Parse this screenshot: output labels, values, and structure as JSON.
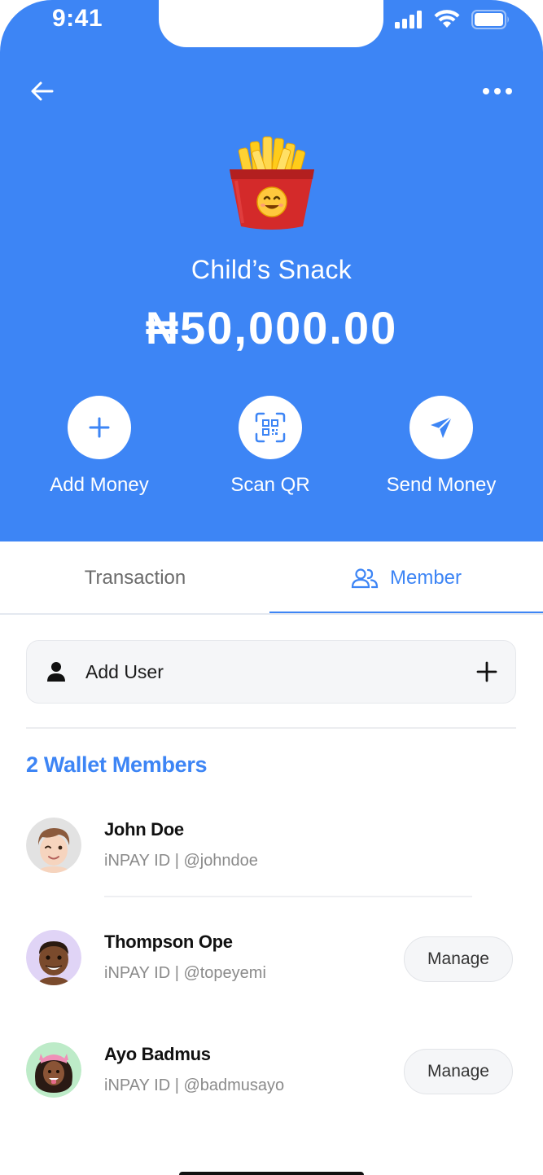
{
  "status_bar": {
    "time": "9:41"
  },
  "wallet": {
    "name": "Child’s Snack",
    "balance": "₦50,000.00",
    "icon": "french-fries-emoji"
  },
  "actions": [
    {
      "label": "Add Money",
      "icon": "plus-icon"
    },
    {
      "label": "Scan QR",
      "icon": "qr-scan-icon"
    },
    {
      "label": "Send Money",
      "icon": "paper-plane-icon"
    }
  ],
  "tabs": [
    {
      "label": "Transaction",
      "active": false
    },
    {
      "label": "Member",
      "active": true,
      "icon": "users-icon"
    }
  ],
  "add_user": {
    "label": "Add User"
  },
  "members_title": "2 Wallet Members",
  "members": [
    {
      "name": "John Doe",
      "handle": "iNPAY ID |  @johndoe",
      "manage": ""
    },
    {
      "name": "Thompson Ope",
      "handle": "iNPAY ID |  @topeyemi",
      "manage": "Manage"
    },
    {
      "name": "Ayo Badmus",
      "handle": "iNPAY ID |  @badmusayo",
      "manage": "Manage"
    }
  ],
  "colors": {
    "primary": "#3D85F5",
    "background": "#FFFFFF",
    "muted_text": "#8A8A8A"
  }
}
